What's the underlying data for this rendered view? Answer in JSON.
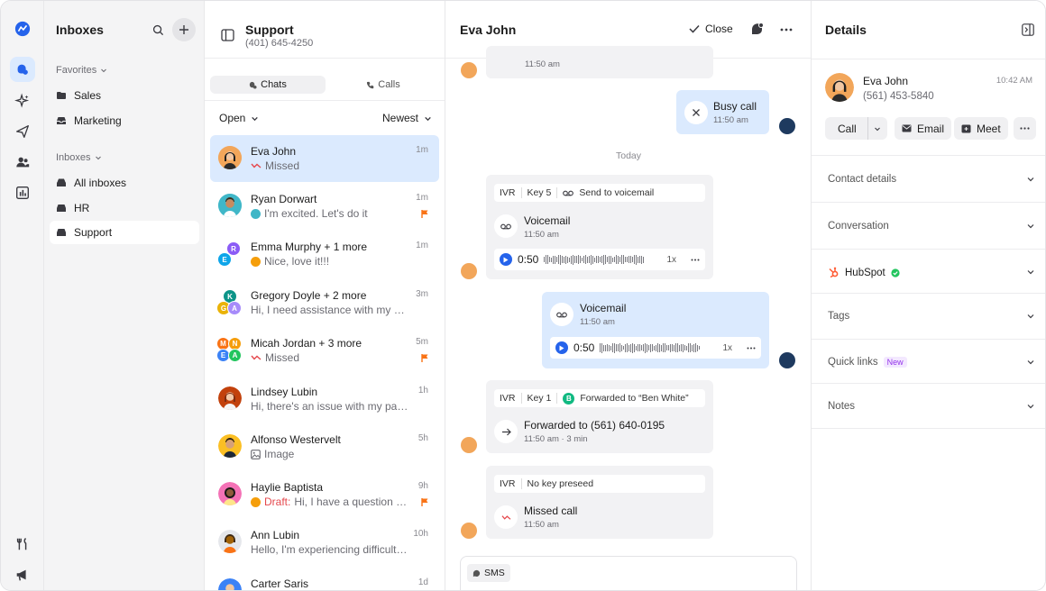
{
  "colors": {
    "accent": "#2563eb",
    "selected_bg": "#dbeafe",
    "flag": "#f97316",
    "missed": "#e5484d",
    "verified": "#22c55e"
  },
  "rail": {
    "icons": [
      "logo-icon",
      "inbox-icon",
      "sparkle-icon",
      "send-icon",
      "contacts-icon",
      "reports-icon",
      "integrations-icon",
      "announcements-icon"
    ]
  },
  "nav": {
    "title": "Inboxes",
    "favorites_label": "Favorites",
    "favorites": [
      "Sales",
      "Marketing"
    ],
    "inboxes_label": "Inboxes",
    "inboxes": [
      "All inboxes",
      "HR",
      "Support"
    ]
  },
  "list": {
    "title": "Support",
    "phone": "(401) 645-4250",
    "tabs": [
      "Chats",
      "Calls"
    ],
    "status_filter": "Open",
    "sort": "Newest",
    "conversations": [
      {
        "name": "Eva John",
        "preview": "Missed",
        "time": "1m"
      },
      {
        "name": "Ryan Dorwart",
        "preview": "I'm excited. Let's do it",
        "time": "1m"
      },
      {
        "name": "Emma Murphy + 1 more",
        "preview": "Nice, love it!!!",
        "time": "1m"
      },
      {
        "name": "Gregory Doyle + 2 more",
        "preview": "Hi, I need assistance with my order",
        "time": "3m"
      },
      {
        "name": "Micah Jordan + 3 more",
        "preview": "Missed",
        "time": "5m"
      },
      {
        "name": "Lindsey Lubin",
        "preview": "Hi, there's an issue with my payment",
        "time": "1h"
      },
      {
        "name": "Alfonso Westervelt",
        "preview": "Image",
        "time": "5h"
      },
      {
        "name": "Haylie Baptista",
        "draft": "Draft:",
        "preview": "Hi, I have a question about",
        "time": "9h"
      },
      {
        "name": "Ann Lubin",
        "preview": "Hello, I'm experiencing difficulties",
        "time": "10h"
      },
      {
        "name": "Carter Saris",
        "preview": "",
        "time": "1d"
      }
    ],
    "avatar_letters": {
      "r": "R",
      "e": "E",
      "k": "K",
      "g": "G",
      "a": "A",
      "m": "M",
      "n": "N"
    }
  },
  "chat": {
    "title": "Eva John",
    "close_label": "Close",
    "top_time": "11:50 am",
    "busy": {
      "title": "Busy call",
      "time": "11:50 am"
    },
    "day": "Today",
    "vm1": {
      "ivr": "IVR",
      "key": "Key 5",
      "action": "Send to voicemail",
      "title": "Voicemail",
      "time": "11:50 am",
      "duration": "0:50",
      "speed": "1x"
    },
    "vm2": {
      "title": "Voicemail",
      "time": "11:50 am",
      "duration": "0:50",
      "speed": "1x"
    },
    "fwd": {
      "ivr": "IVR",
      "key": "Key 1",
      "badge": "B",
      "action": "Forwarded to “Ben White”",
      "title": "Forwarded to (561) 640-0195",
      "time": "11:50 am · 3 min"
    },
    "missed": {
      "ivr": "IVR",
      "key": "No key preseed",
      "title": "Missed call",
      "time": "11:50 am"
    },
    "composer_channel": "SMS"
  },
  "details": {
    "title": "Details",
    "contact_name": "Eva John",
    "contact_phone": "(561) 453-5840",
    "contact_time": "10:42 AM",
    "actions": [
      "Call",
      "Email",
      "Meet"
    ],
    "sections": [
      "Contact details",
      "Conversation",
      "HubSpot",
      "Tags",
      "Quick links",
      "Notes"
    ],
    "new_badge": "New"
  }
}
